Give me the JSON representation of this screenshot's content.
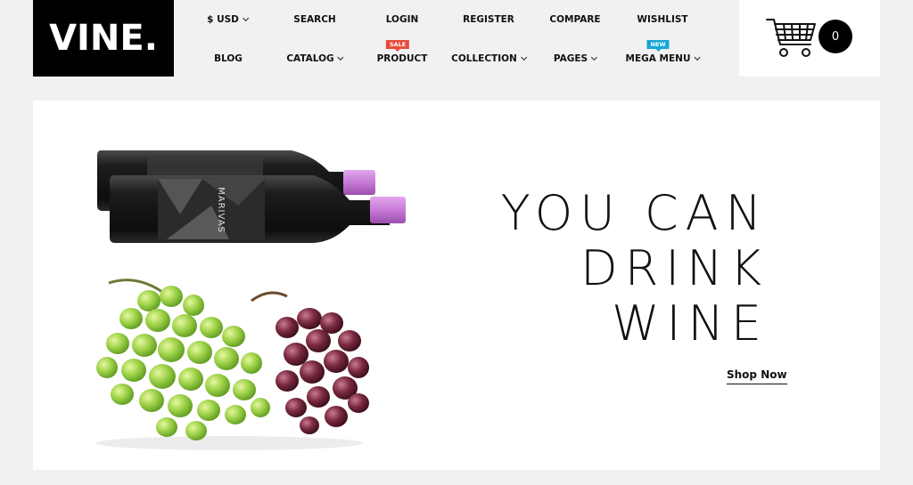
{
  "logo": {
    "text": "VINE."
  },
  "nav": {
    "row1": [
      {
        "label": "$ USD",
        "dropdown": true
      },
      {
        "label": "SEARCH",
        "dropdown": false
      },
      {
        "label": "LOGIN",
        "dropdown": false
      },
      {
        "label": "REGISTER",
        "dropdown": false
      },
      {
        "label": "COMPARE",
        "dropdown": false
      },
      {
        "label": "WISHLIST",
        "dropdown": false
      }
    ],
    "row2": [
      {
        "label": "BLOG",
        "dropdown": false
      },
      {
        "label": "CATALOG",
        "dropdown": true
      },
      {
        "label": "PRODUCT",
        "dropdown": false,
        "badge": "SALE"
      },
      {
        "label": "COLLECTION",
        "dropdown": true
      },
      {
        "label": "PAGES",
        "dropdown": true
      },
      {
        "label": "MEGA MENU",
        "dropdown": true,
        "badge": "NEW"
      }
    ]
  },
  "cart": {
    "count": "0",
    "icon": "shopping-cart-icon"
  },
  "hero": {
    "headline": [
      "YOU CAN",
      "DRINK",
      "WINE"
    ],
    "cta": "Shop Now",
    "bottle_label": "MARIVAS"
  },
  "colors": {
    "background": "#f1f1f1",
    "logo_bg": "#000000",
    "sale_badge": "#e74c3c",
    "new_badge": "#17a6d9",
    "bottle_cap": "#c77ad6"
  }
}
